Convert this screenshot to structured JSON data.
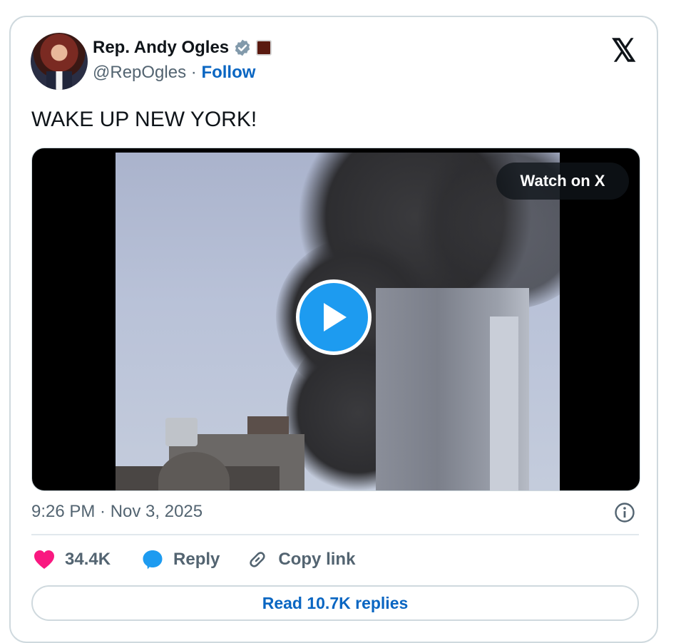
{
  "tweet": {
    "display_name": "Rep. Andy Ogles",
    "handle": "@RepOgles",
    "separator": "·",
    "follow_label": "Follow",
    "text": "WAKE UP NEW YORK!",
    "timestamp": "9:26 PM · Nov 3, 2025"
  },
  "media": {
    "watch_label": "Watch on X",
    "play_icon": "play-icon"
  },
  "actions": {
    "likes": "34.4K",
    "reply_label": "Reply",
    "copy_label": "Copy link",
    "read_replies_label": "Read 10.7K replies"
  },
  "colors": {
    "accent": "#1d9bf0",
    "link": "#0a66c2",
    "heart": "#f91880",
    "muted": "#536471"
  },
  "icons": {
    "brand": "x-logo-icon",
    "verified": "verified-badge-icon",
    "affiliation": "affiliation-badge-icon",
    "heart": "heart-icon",
    "reply": "reply-bubble-icon",
    "link": "link-icon",
    "info": "info-icon"
  }
}
